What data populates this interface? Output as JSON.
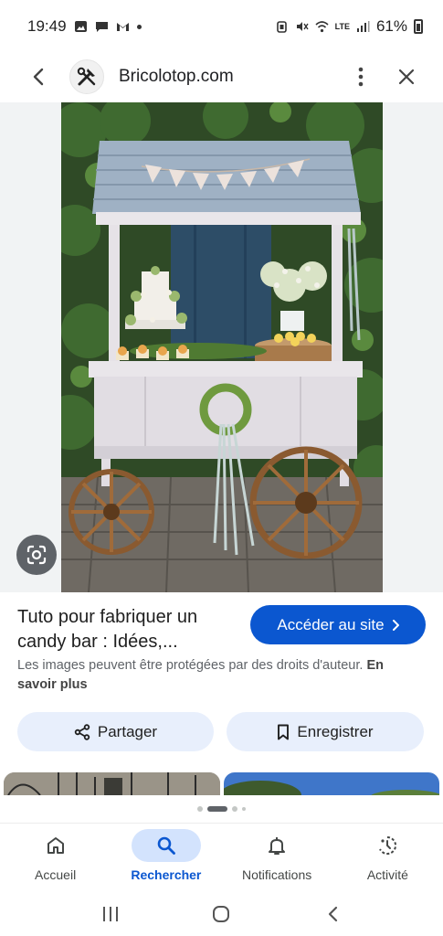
{
  "status_bar": {
    "time": "19:49",
    "battery": "61%",
    "network": "LTE"
  },
  "header": {
    "site_name": "Bricolotop.com",
    "icons": [
      "back-arrow-icon",
      "site-logo-icon",
      "more-vert-icon",
      "close-icon"
    ]
  },
  "result": {
    "title": "Tuto pour fabriquer un candy bar : Idées,...",
    "visit_label": "Accéder au site",
    "copyright_text": "Les images peuvent être protégées par des droits d'auteur.",
    "learn_more": "En savoir plus",
    "share_label": "Partager",
    "save_label": "Enregistrer"
  },
  "bottom_nav": {
    "items": [
      {
        "label": "Accueil",
        "icon": "home-icon",
        "active": false
      },
      {
        "label": "Rechercher",
        "icon": "search-icon",
        "active": true
      },
      {
        "label": "Notifications",
        "icon": "bell-icon",
        "active": false
      },
      {
        "label": "Activité",
        "icon": "activity-icon",
        "active": false
      }
    ]
  },
  "colors": {
    "accent": "#0b57d0",
    "pill_bg": "#e8effc",
    "active_nav_bg": "#d3e3fd"
  }
}
